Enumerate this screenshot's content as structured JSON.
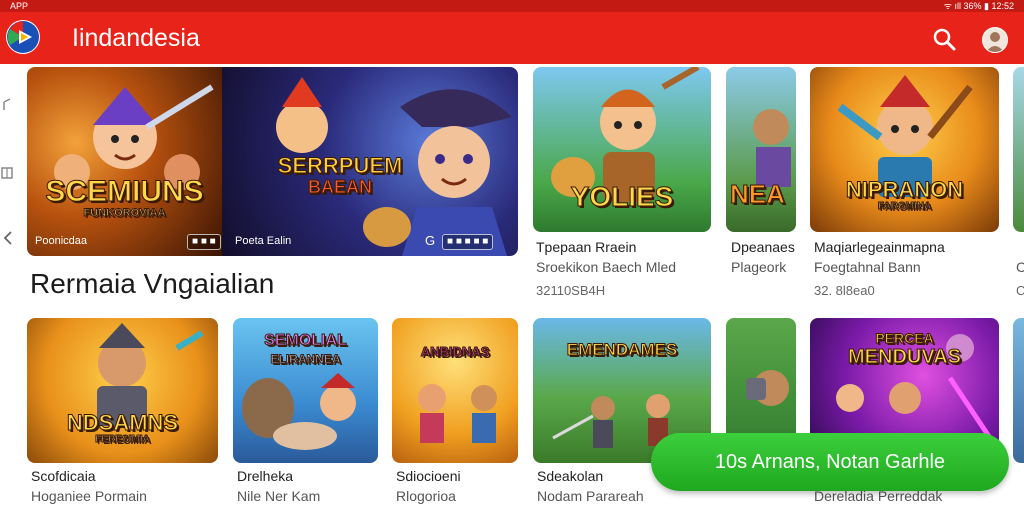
{
  "status_bar": {
    "left": "APP",
    "right": "ᯤ ıll 36%  ▮ 12:52"
  },
  "app_bar": {
    "title": "Iindandesia"
  },
  "featured": [
    {
      "caption": "Poonicdaa",
      "badge": "■ ■ ■",
      "art_text": "SCEMIUNS",
      "art_sub": "FUNKOROVIAA"
    },
    {
      "caption": "Poeta Ealin",
      "badge": "■ ■ ■ ■ ■",
      "art_text": "SERRPUEM",
      "art_sub": "BAEAN",
      "glyph": "G"
    }
  ],
  "top_row_apps": [
    {
      "art_text": "YOLIES",
      "line1": "Tpepaan Rraein",
      "line2": "Sroekikon Baech Mled",
      "line3": "32110SB4H"
    },
    {
      "art_text": "NEA",
      "line1": "Dpeanaes",
      "line2": "Plageork",
      "line3": ""
    },
    {
      "art_text": "NIPRANON",
      "art_sub": "FARGMINA",
      "line1": "Maqiarlegeainmapna",
      "line2": "Foegtahnal Bann",
      "line3": "32. 8l8ea0"
    },
    {
      "art_text": "",
      "line1": "",
      "line2": "C",
      "line3": "C"
    }
  ],
  "section": {
    "title": "Rermaia Vngaialian"
  },
  "bottom_row_apps": [
    {
      "art_text": "NDSAMNS",
      "art_sub": "FERESIMIA",
      "line1": "Scofdicaia",
      "line2": "Hoganiee Pormain"
    },
    {
      "art_text": "SEMOLIAL",
      "art_sub": "ELIRANNEA",
      "line1": "Drelheka",
      "line2": "Nile Ner Kam"
    },
    {
      "art_text": "ANBIDNAS",
      "line1": "Sdiocioeni",
      "line2": "Rlogorioa"
    },
    {
      "art_text": "EMENDAMES",
      "line1": "Sdeakolan",
      "line2": "Nodam Parareah"
    },
    {
      "art_text": "",
      "line1": "",
      "line2": ""
    },
    {
      "art_text": "MENDUVAS",
      "art_sub": "PERCEA",
      "line1": "",
      "line2": "Dereladia Perreddak"
    }
  ],
  "cta": {
    "label": "10s Arnans, Notan Garhle"
  },
  "colors": {
    "app_bar": "#e8241a",
    "status_bar": "#c41a14",
    "cta": "#2bbd2b"
  }
}
